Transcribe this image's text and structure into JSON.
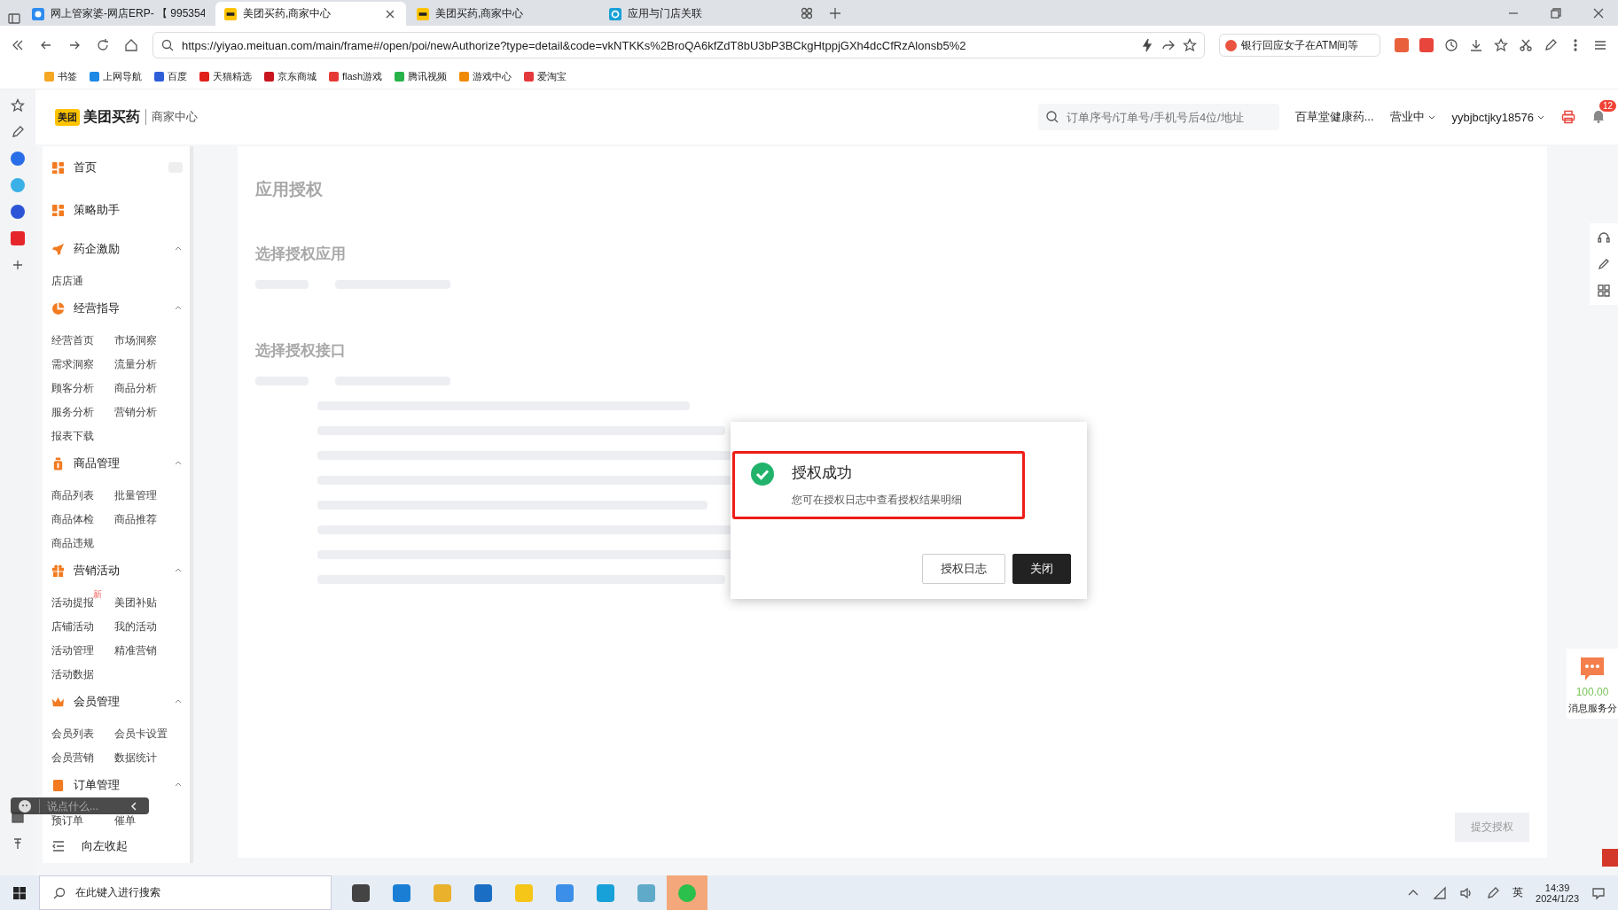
{
  "browser": {
    "tabs": [
      {
        "title": "网上管家婆-网店ERP- 【 995354",
        "selected": false
      },
      {
        "title": "美团买药,商家中心",
        "selected": true
      },
      {
        "title": "美团买药,商家中心",
        "selected": false
      },
      {
        "title": "应用与门店关联",
        "selected": false
      }
    ],
    "url": "https://yiyao.meituan.com/main/frame#/open/poi/newAuthorize?type=detail&code=vkNTKKs%2BroQA6kfZdT8bU3bP3BCkgHtppjGXh4dcCfRzAlonsb5%2",
    "news_search": "银行回应女子在ATM间等",
    "bookmarks": [
      {
        "label": "书签",
        "color": "#f5a623"
      },
      {
        "label": "上网导航",
        "color": "#1e88e5"
      },
      {
        "label": "百度",
        "color": "#2f5fd8"
      },
      {
        "label": "天猫精选",
        "color": "#e0211b"
      },
      {
        "label": "京东商城",
        "color": "#c9151e"
      },
      {
        "label": "flash游戏",
        "color": "#e53935"
      },
      {
        "label": "腾讯视频",
        "color": "#27b24a"
      },
      {
        "label": "游戏中心",
        "color": "#f08a00"
      },
      {
        "label": "爱淘宝",
        "color": "#e4393c"
      }
    ]
  },
  "header": {
    "logo_badge": "美团",
    "brand": "美团买药",
    "subtitle": "商家中心",
    "search_placeholder": "订单序号/订单号/手机号后4位/地址",
    "store": "百草堂健康药...",
    "status": "营业中",
    "account": "yybjbctjky18576",
    "notification_count": "12"
  },
  "sidebar": {
    "items": [
      {
        "kind": "link",
        "label": "首页"
      },
      {
        "kind": "link",
        "label": "策略助手"
      },
      {
        "kind": "group",
        "label": "药企激励",
        "expanded": true,
        "children": [
          {
            "label": "店店通"
          }
        ]
      },
      {
        "kind": "group",
        "label": "经营指导",
        "expanded": true,
        "children": [
          {
            "label": "经营首页"
          },
          {
            "label": "市场洞察"
          },
          {
            "label": "需求洞察"
          },
          {
            "label": "流量分析"
          },
          {
            "label": "顾客分析"
          },
          {
            "label": "商品分析"
          },
          {
            "label": "服务分析"
          },
          {
            "label": "营销分析"
          },
          {
            "label": "报表下载"
          }
        ]
      },
      {
        "kind": "group",
        "label": "商品管理",
        "expanded": true,
        "children": [
          {
            "label": "商品列表"
          },
          {
            "label": "批量管理"
          },
          {
            "label": "商品体检"
          },
          {
            "label": "商品推荐"
          },
          {
            "label": "商品违规"
          }
        ]
      },
      {
        "kind": "group",
        "label": "营销活动",
        "expanded": true,
        "children": [
          {
            "label": "活动提报",
            "badge": "新"
          },
          {
            "label": "美团补贴"
          },
          {
            "label": "店铺活动"
          },
          {
            "label": "我的活动"
          },
          {
            "label": "活动管理"
          },
          {
            "label": "精准营销"
          },
          {
            "label": "活动数据"
          }
        ]
      },
      {
        "kind": "group",
        "label": "会员管理",
        "expanded": true,
        "children": [
          {
            "label": "会员列表"
          },
          {
            "label": "会员卡设置"
          },
          {
            "label": "会员营销"
          },
          {
            "label": "数据统计"
          }
        ]
      },
      {
        "kind": "group",
        "label": "订单管理",
        "expanded": true,
        "children": [
          {
            "label": "预订单"
          },
          {
            "label": "催单"
          }
        ]
      }
    ],
    "collapse": "向左收起"
  },
  "page": {
    "title": "应用授权",
    "sections": [
      "选择授权应用",
      "选择授权接口"
    ],
    "submit": "提交授权"
  },
  "dialog": {
    "title": "授权成功",
    "message": "您可在授权日志中查看授权结果明细",
    "buttons": [
      {
        "label": "授权日志",
        "kind": "secondary"
      },
      {
        "label": "关闭",
        "kind": "primary"
      }
    ]
  },
  "comment_box": {
    "placeholder": "说点什么..."
  },
  "service_score": {
    "value": "100.00",
    "label": "消息服务分"
  },
  "taskbar": {
    "search_placeholder": "在此键入进行搜索",
    "ime": "英",
    "time": "14:39",
    "date": "2024/1/23"
  }
}
